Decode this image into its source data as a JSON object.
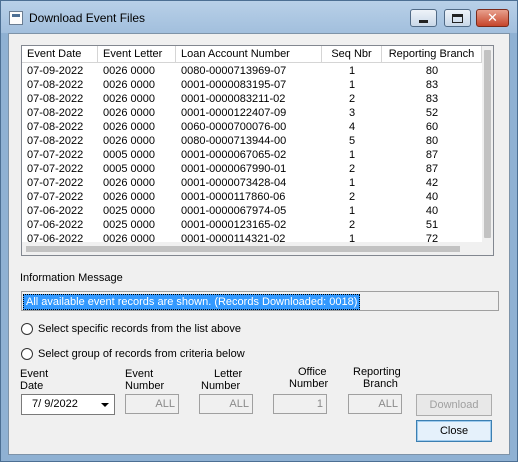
{
  "window": {
    "title": "Download Event Files"
  },
  "list": {
    "columns": [
      "Event Date",
      "Event Letter",
      "Loan Account Number",
      "Seq Nbr",
      "Reporting Branch"
    ],
    "rows": [
      [
        "07-09-2022",
        "0026 0000",
        "0080-0000713969-07",
        "1",
        "80"
      ],
      [
        "07-08-2022",
        "0026 0000",
        "0001-0000083195-07",
        "1",
        "83"
      ],
      [
        "07-08-2022",
        "0026 0000",
        "0001-0000083211-02",
        "2",
        "83"
      ],
      [
        "07-08-2022",
        "0026 0000",
        "0001-0000122407-09",
        "3",
        "52"
      ],
      [
        "07-08-2022",
        "0026 0000",
        "0060-0000700076-00",
        "4",
        "60"
      ],
      [
        "07-08-2022",
        "0026 0000",
        "0080-0000713944-00",
        "5",
        "80"
      ],
      [
        "07-07-2022",
        "0005 0000",
        "0001-0000067065-02",
        "1",
        "87"
      ],
      [
        "07-07-2022",
        "0005 0000",
        "0001-0000067990-01",
        "2",
        "87"
      ],
      [
        "07-07-2022",
        "0026 0000",
        "0001-0000073428-04",
        "1",
        "42"
      ],
      [
        "07-07-2022",
        "0026 0000",
        "0001-0000117860-06",
        "2",
        "40"
      ],
      [
        "07-06-2022",
        "0025 0000",
        "0001-0000067974-05",
        "1",
        "40"
      ],
      [
        "07-06-2022",
        "0025 0000",
        "0001-0000123165-02",
        "2",
        "51"
      ],
      [
        "07-06-2022",
        "0026 0000",
        "0001-0000114321-02",
        "1",
        "72"
      ]
    ]
  },
  "info": {
    "label": "Information Message",
    "message": "All available event records are shown.  (Records Downloaded: 0018)"
  },
  "options": {
    "specific": "Select specific records from the list above",
    "group": "Select group of records from criteria below"
  },
  "criteria": {
    "event_date_label_1": "Event",
    "event_date_label_2": "Date",
    "event_date_value": "7/  9/2022",
    "event_number_label_1": "Event",
    "event_number_label_2": "Number",
    "event_number_value": "ALL",
    "letter_number_label_1": "Letter",
    "letter_number_label_2": "Number",
    "letter_number_value": "ALL",
    "office_number_label_1": "Office",
    "office_number_label_2": "Number",
    "office_number_value": "1",
    "reporting_branch_label_1": "Reporting",
    "reporting_branch_label_2": "Branch",
    "reporting_branch_value": "ALL"
  },
  "buttons": {
    "download": "Download",
    "close": "Close"
  }
}
